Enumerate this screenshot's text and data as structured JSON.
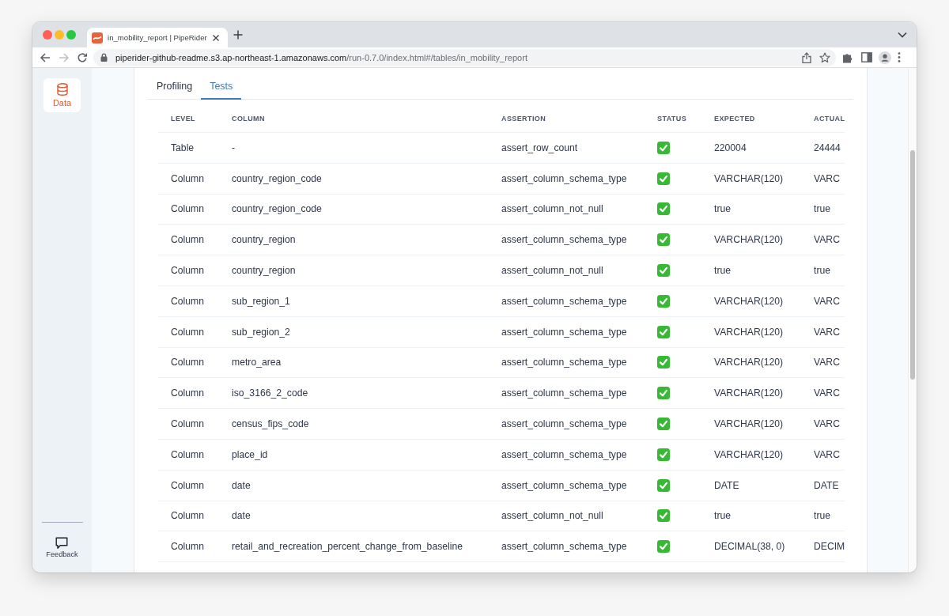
{
  "browser": {
    "tab": {
      "title": "in_mobility_report | PipeRider"
    },
    "nav": [
      {
        "kind": "back",
        "disabled": false
      },
      {
        "kind": "forward",
        "disabled": true
      },
      {
        "kind": "reload",
        "disabled": false
      }
    ],
    "url": {
      "host": "piperider-github-readme.s3.ap-northeast-1.amazonaws.com",
      "path": "/run-0.7.0/index.html#/tables/in_mobility_report"
    }
  },
  "sidebar": {
    "items": [
      {
        "label": "Data",
        "selected": true
      }
    ],
    "footer": {
      "label": "Feedback"
    }
  },
  "tabs": [
    {
      "label": "Profiling",
      "selected": false
    },
    {
      "label": "Tests",
      "selected": true
    }
  ],
  "table": {
    "columns": [
      "LEVEL",
      "COLUMN",
      "ASSERTION",
      "STATUS",
      "EXPECTED",
      "ACTUAL"
    ],
    "rows": [
      {
        "level": "Table",
        "column": "-",
        "assertion": "assert_row_count",
        "passed": true,
        "expected": "220004",
        "actual": "24444"
      },
      {
        "level": "Column",
        "column": "country_region_code",
        "assertion": "assert_column_schema_type",
        "passed": true,
        "expected": "VARCHAR(120)",
        "actual": "VARC"
      },
      {
        "level": "Column",
        "column": "country_region_code",
        "assertion": "assert_column_not_null",
        "passed": true,
        "expected": "true",
        "actual": "true"
      },
      {
        "level": "Column",
        "column": "country_region",
        "assertion": "assert_column_schema_type",
        "passed": true,
        "expected": "VARCHAR(120)",
        "actual": "VARC"
      },
      {
        "level": "Column",
        "column": "country_region",
        "assertion": "assert_column_not_null",
        "passed": true,
        "expected": "true",
        "actual": "true"
      },
      {
        "level": "Column",
        "column": "sub_region_1",
        "assertion": "assert_column_schema_type",
        "passed": true,
        "expected": "VARCHAR(120)",
        "actual": "VARC"
      },
      {
        "level": "Column",
        "column": "sub_region_2",
        "assertion": "assert_column_schema_type",
        "passed": true,
        "expected": "VARCHAR(120)",
        "actual": "VARC"
      },
      {
        "level": "Column",
        "column": "metro_area",
        "assertion": "assert_column_schema_type",
        "passed": true,
        "expected": "VARCHAR(120)",
        "actual": "VARC"
      },
      {
        "level": "Column",
        "column": "iso_3166_2_code",
        "assertion": "assert_column_schema_type",
        "passed": true,
        "expected": "VARCHAR(120)",
        "actual": "VARC"
      },
      {
        "level": "Column",
        "column": "census_fips_code",
        "assertion": "assert_column_schema_type",
        "passed": true,
        "expected": "VARCHAR(120)",
        "actual": "VARC"
      },
      {
        "level": "Column",
        "column": "place_id",
        "assertion": "assert_column_schema_type",
        "passed": true,
        "expected": "VARCHAR(120)",
        "actual": "VARC"
      },
      {
        "level": "Column",
        "column": "date",
        "assertion": "assert_column_schema_type",
        "passed": true,
        "expected": "DATE",
        "actual": "DATE"
      },
      {
        "level": "Column",
        "column": "date",
        "assertion": "assert_column_not_null",
        "passed": true,
        "expected": "true",
        "actual": "true"
      },
      {
        "level": "Column",
        "column": "retail_and_recreation_percent_change_from_baseline",
        "assertion": "assert_column_schema_type",
        "passed": true,
        "expected": "DECIMAL(38, 0)",
        "actual": "DECIM"
      }
    ]
  }
}
